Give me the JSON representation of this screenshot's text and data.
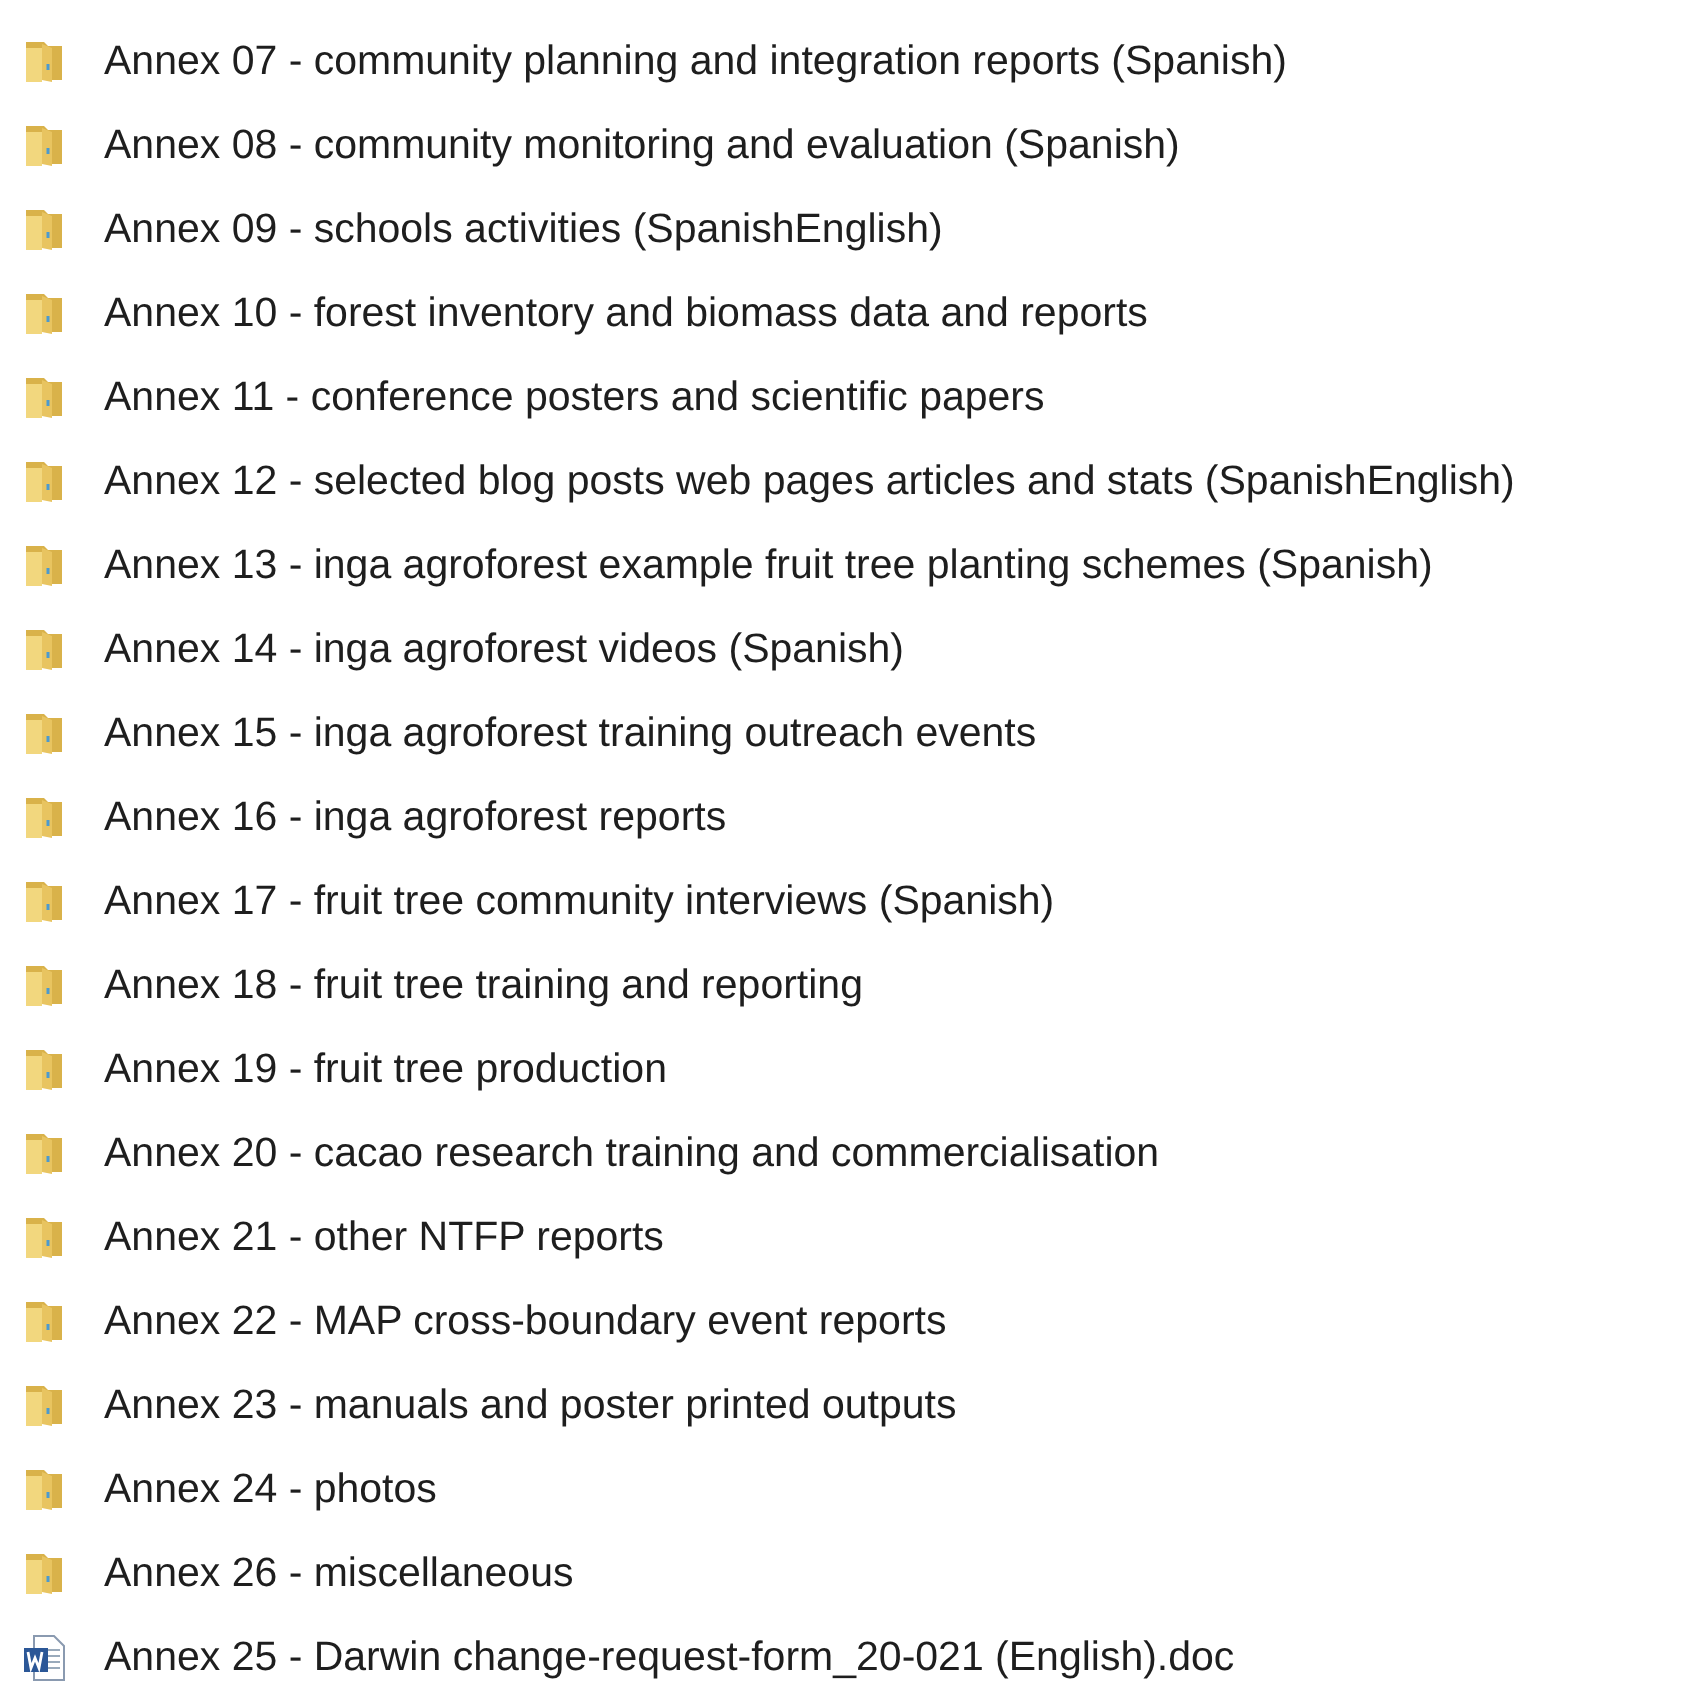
{
  "items": [
    {
      "kind": "folder",
      "name": "Annex 07 - community planning and integration reports (Spanish)"
    },
    {
      "kind": "folder",
      "name": "Annex 08 - community monitoring and evaluation (Spanish)"
    },
    {
      "kind": "folder",
      "name": "Annex 09 - schools activities (SpanishEnglish)"
    },
    {
      "kind": "folder",
      "name": "Annex 10 - forest inventory and biomass data and reports"
    },
    {
      "kind": "folder",
      "name": "Annex 11 - conference posters and scientific papers"
    },
    {
      "kind": "folder",
      "name": "Annex 12 - selected blog posts web pages articles and stats (SpanishEnglish)"
    },
    {
      "kind": "folder",
      "name": "Annex 13 - inga agroforest example fruit tree planting schemes (Spanish)"
    },
    {
      "kind": "folder",
      "name": "Annex 14 - inga agroforest videos (Spanish)"
    },
    {
      "kind": "folder",
      "name": "Annex 15 - inga agroforest training outreach events"
    },
    {
      "kind": "folder",
      "name": "Annex 16 - inga agroforest reports"
    },
    {
      "kind": "folder",
      "name": "Annex 17 - fruit tree community interviews (Spanish)"
    },
    {
      "kind": "folder",
      "name": "Annex 18 - fruit tree training and reporting"
    },
    {
      "kind": "folder",
      "name": "Annex 19 - fruit tree production"
    },
    {
      "kind": "folder",
      "name": "Annex 20 - cacao research training and commercialisation"
    },
    {
      "kind": "folder",
      "name": "Annex 21 - other NTFP reports"
    },
    {
      "kind": "folder",
      "name": "Annex 22 - MAP cross-boundary event reports"
    },
    {
      "kind": "folder",
      "name": "Annex 23 - manuals and poster printed outputs"
    },
    {
      "kind": "folder",
      "name": "Annex 24 - photos"
    },
    {
      "kind": "folder",
      "name": "Annex 26 - miscellaneous"
    },
    {
      "kind": "document",
      "name": "Annex 25 - Darwin change-request-form_20-021 (English).doc"
    }
  ]
}
